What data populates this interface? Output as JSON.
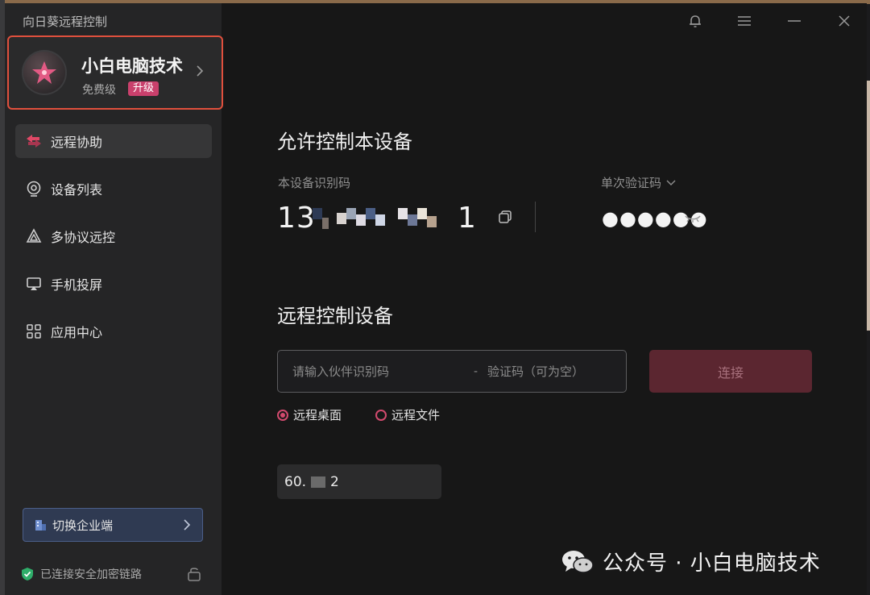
{
  "app": {
    "title": "向日葵远程控制"
  },
  "profile": {
    "name": "小白电脑技术",
    "plan": "免费级",
    "upgrade_label": "升级"
  },
  "nav": {
    "items": [
      {
        "label": "远程协助",
        "icon": "swap-arrows-icon",
        "active": true
      },
      {
        "label": "设备列表",
        "icon": "device-list-icon",
        "active": false
      },
      {
        "label": "多协议远控",
        "icon": "multi-protocol-icon",
        "active": false
      },
      {
        "label": "手机投屏",
        "icon": "screen-cast-icon",
        "active": false
      },
      {
        "label": "应用中心",
        "icon": "app-grid-icon",
        "active": false
      }
    ]
  },
  "enterprise": {
    "label": "切换企业端"
  },
  "security": {
    "status": "已连接安全加密链路"
  },
  "allow": {
    "title": "允许控制本设备",
    "device_id_label": "本设备识别码",
    "device_id_prefix": "13",
    "device_id_suffix": "1",
    "verify_label": "单次验证码",
    "verify_code": "●●●●●●"
  },
  "remote": {
    "title": "远程控制设备",
    "partner_id_placeholder": "请输入伙伴识别码",
    "separator": "-",
    "verify_placeholder": "验证码（可为空）",
    "connect_label": "连接",
    "modes": [
      {
        "label": "远程桌面",
        "selected": true
      },
      {
        "label": "远程文件",
        "selected": false
      }
    ],
    "history": {
      "prefix": "60.",
      "suffix": "2"
    }
  },
  "watermark": {
    "text": "公众号 · 小白电脑技术"
  },
  "colors": {
    "accent": "#d24a6e",
    "highlight_border": "#e0503d",
    "upgrade_badge": "#c9406c"
  }
}
